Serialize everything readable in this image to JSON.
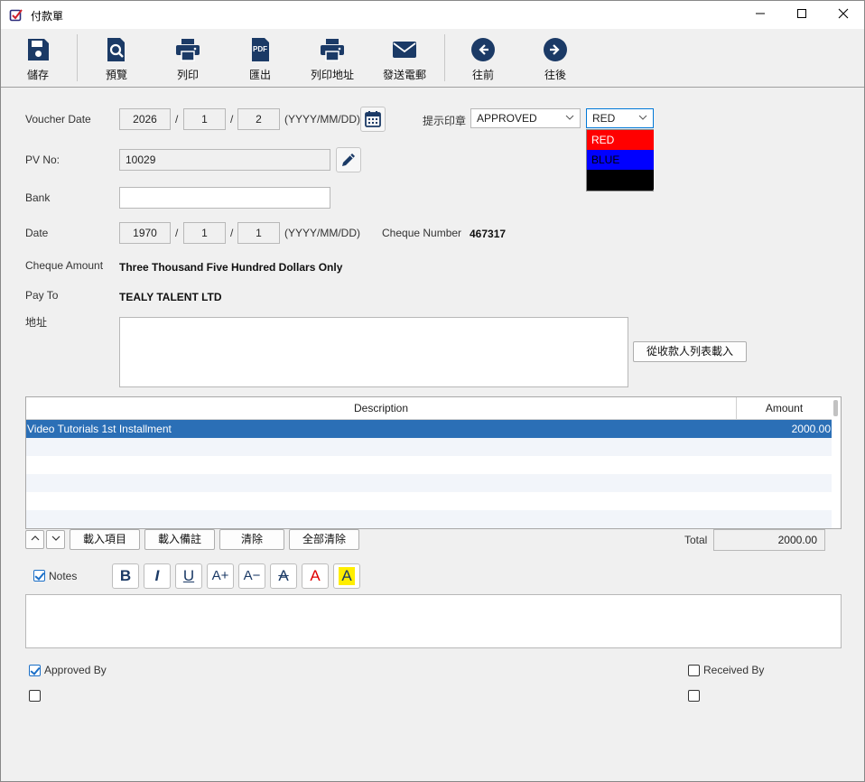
{
  "window": {
    "title": "付款單",
    "minimize_glyph": "—",
    "maximize_glyph": "☐",
    "close_glyph": "✕"
  },
  "toolbar": {
    "save": "儲存",
    "preview": "預覽",
    "print": "列印",
    "export": "匯出",
    "print_address": "列印地址",
    "send_email": "發送電郵",
    "previous": "往前",
    "next": "往後"
  },
  "form": {
    "voucher_date_label": "Voucher Date",
    "voucher_date": {
      "year": "2026",
      "month": "1",
      "day": "2"
    },
    "date_sep": "/",
    "date_format": "(YYYY/MM/DD)",
    "stamp_label": "提示印章",
    "stamp_value": "APPROVED",
    "color_value": "RED",
    "color_options": [
      "RED",
      "BLUE",
      ""
    ],
    "pv_no_label": "PV No:",
    "pv_no": "10029",
    "bank_label": "Bank",
    "bank": "",
    "date_label": "Date",
    "date": {
      "year": "1970",
      "month": "1",
      "day": "1"
    },
    "cheque_number_label": "Cheque Number",
    "cheque_number": "467317",
    "cheque_amount_label": "Cheque Amount",
    "cheque_amount": "Three Thousand Five Hundred Dollars Only",
    "pay_to_label": "Pay To",
    "pay_to": "TEALY TALENT LTD",
    "address_label": "地址",
    "address": "",
    "load_payee_button": "從收款人列表載入"
  },
  "table": {
    "columns": [
      "Description",
      "Amount"
    ],
    "rows": [
      {
        "description": "Video Tutorials 1st Installment",
        "amount": "2000.00"
      }
    ]
  },
  "table_actions": {
    "load_items": "載入項目",
    "load_remarks": "載入備註",
    "clear": "清除",
    "clear_all": "全部清除",
    "total_label": "Total",
    "total": "2000.00"
  },
  "notes": {
    "label": "Notes",
    "checked": true,
    "format_buttons": [
      "B",
      "I",
      "U",
      "A+",
      "A−",
      "A",
      "A",
      "A"
    ]
  },
  "signoff": {
    "approved_by_label": "Approved By",
    "approved_checked": true,
    "received_by_label": "Received By",
    "received_checked": false
  },
  "colors": {
    "accent": "#1b3a66",
    "selection": "#2b6fb6",
    "red": "#ff0000",
    "blue": "#0000ff"
  }
}
